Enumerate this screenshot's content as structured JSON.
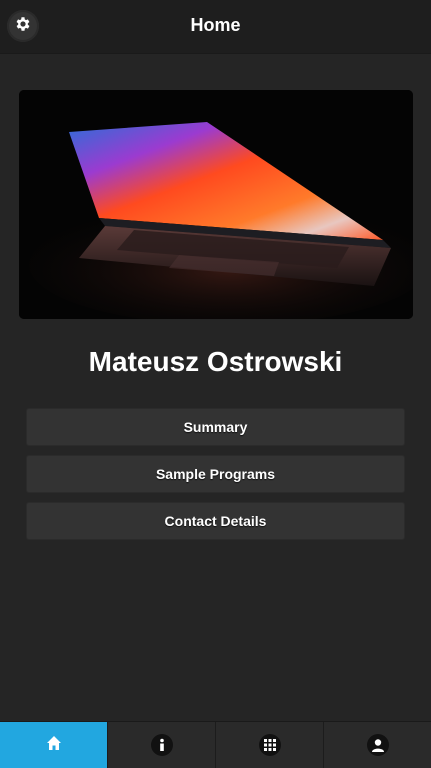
{
  "header": {
    "title": "Home",
    "settings_icon": "gear-icon"
  },
  "hero": {
    "image_subject": "laptop-photo"
  },
  "profile": {
    "name": "Mateusz Ostrowski"
  },
  "menu": {
    "summary_label": "Summary",
    "samples_label": "Sample Programs",
    "contact_label": "Contact Details"
  },
  "tabbar": {
    "tabs": [
      {
        "icon": "home-icon",
        "active": true
      },
      {
        "icon": "info-icon",
        "active": false
      },
      {
        "icon": "grid-icon",
        "active": false
      },
      {
        "icon": "user-icon",
        "active": false
      }
    ],
    "active_color": "#22a7e0"
  },
  "colors": {
    "background": "#252525",
    "header": "#1e1e1e",
    "button": "#333333"
  }
}
